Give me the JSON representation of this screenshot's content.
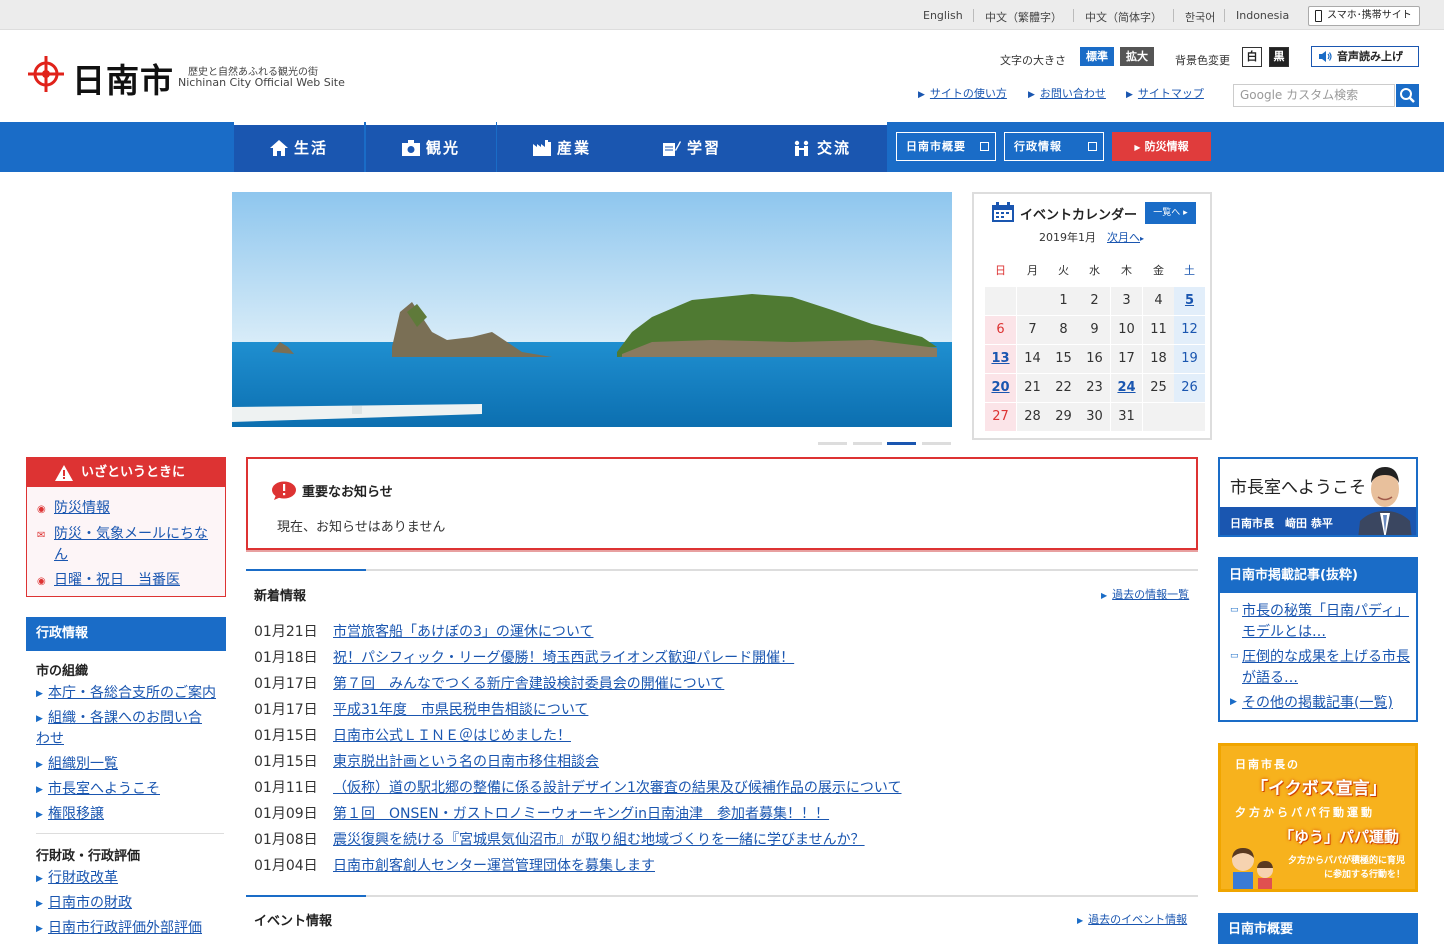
{
  "language_bar": {
    "languages": [
      "English",
      "中文（繁體字）",
      "中文（简体字）",
      "한국어",
      "Indonesia"
    ],
    "mobile_site": "スマホ･携帯サイト"
  },
  "header": {
    "site_name": "日南市",
    "tagline_ja": "歴史と自然あふれる観光の街",
    "tagline_en": "Nichinan City Official Web Site",
    "font_size_label": "文字の大きさ",
    "font_size_normal": "標準",
    "font_size_large": "拡大",
    "bg_color_label": "背景色変更",
    "bg_white": "白",
    "bg_black": "黒",
    "read_aloud": "音声読み上げ",
    "links": [
      "サイトの使い方",
      "お問い合わせ",
      "サイトマップ"
    ],
    "search_placeholder": "Google カスタム検索"
  },
  "nav": {
    "main": [
      "生活",
      "観光",
      "産業",
      "学習",
      "交流"
    ],
    "buttons": [
      "日南市概要",
      "行政情報"
    ],
    "disaster": "防災情報"
  },
  "calendar": {
    "title": "イベントカレンダー",
    "list_button": "一覧へ",
    "month": "2019年1月",
    "next_month": "次月へ",
    "weekdays": [
      "日",
      "月",
      "火",
      "水",
      "木",
      "金",
      "土"
    ],
    "weeks": [
      [
        "",
        "",
        "1",
        "2",
        "3",
        "4",
        "5"
      ],
      [
        "6",
        "7",
        "8",
        "9",
        "10",
        "11",
        "12"
      ],
      [
        "13",
        "14",
        "15",
        "16",
        "17",
        "18",
        "19"
      ],
      [
        "20",
        "21",
        "22",
        "23",
        "24",
        "25",
        "26"
      ],
      [
        "27",
        "28",
        "29",
        "30",
        "31",
        "",
        ""
      ]
    ],
    "event_days": [
      "5",
      "13",
      "20",
      "24"
    ]
  },
  "emergency": {
    "title": "いざというときに",
    "links": [
      "防災情報",
      "防災・気象メールにちなん",
      "日曜・祝日　当番医"
    ]
  },
  "admin": {
    "title": "行政情報",
    "group1_title": "市の組織",
    "group1_links": [
      "本庁・各総合支所のご案内",
      "組織・各課へのお問い合わせ",
      "組織別一覧",
      "市長室へようこそ",
      "権限移譲"
    ],
    "group2_title": "行財政・行政評価",
    "group2_links": [
      "行財政改革",
      "日南市の財政",
      "日南市行政評価外部評価"
    ]
  },
  "notice": {
    "title": "重要なお知らせ",
    "body": "現在、お知らせはありません"
  },
  "news": {
    "title": "新着情報",
    "more": "過去の情報一覧",
    "items": [
      {
        "date": "01月21日",
        "title": "市営旅客船「あけぼの3」の運休について"
      },
      {
        "date": "01月18日",
        "title": "祝！パシフィック・リーグ優勝！埼玉西武ライオンズ歓迎パレード開催！"
      },
      {
        "date": "01月17日",
        "title": "第７回　みんなでつくる新庁舎建設検討委員会の開催について"
      },
      {
        "date": "01月17日",
        "title": "平成31年度　市県民税申告相談について"
      },
      {
        "date": "01月15日",
        "title": "日南市公式ＬＩＮＥ＠はじめました！"
      },
      {
        "date": "01月15日",
        "title": "東京脱出計画という名の日南市移住相談会"
      },
      {
        "date": "01月11日",
        "title": "（仮称）道の駅北郷の整備に係る設計デザイン1次審査の結果及び候補作品の展示について"
      },
      {
        "date": "01月09日",
        "title": "第１回　ONSEN・ガストロノミーウォーキングin日南油津　参加者募集！！！"
      },
      {
        "date": "01月08日",
        "title": "震災復興を続ける『宮城県気仙沼市』が取り組む地域づくりを一緒に学びませんか？"
      },
      {
        "date": "01月04日",
        "title": "日南市創客創人センター運営管理団体を募集します"
      }
    ]
  },
  "events": {
    "title": "イベント情報",
    "more": "過去のイベント情報"
  },
  "mayor": {
    "title": "市長室へようこそ",
    "name": "日南市長　﨑田 恭平"
  },
  "articles": {
    "title": "日南市掲載記事(抜粋)",
    "links": [
      "市長の秘策「日南パディ」モデルとは…",
      "圧倒的な成果を上げる市長が語る…",
      "その他の掲載記事(一覧)"
    ]
  },
  "banner": {
    "line1": "日南市長の",
    "line2": "「イクボス宣言」",
    "line3": "夕方からパパ行動運動",
    "line4": "「ゆう」パパ運動",
    "line5": "夕方からパパが積極的に育児に参加する行動を！"
  },
  "overview": {
    "title": "日南市概要"
  },
  "colors": {
    "primary": "#1a6cc7",
    "primary_dark": "#1a56b0",
    "alert": "#dd3333",
    "banner": "#f7b21d"
  }
}
